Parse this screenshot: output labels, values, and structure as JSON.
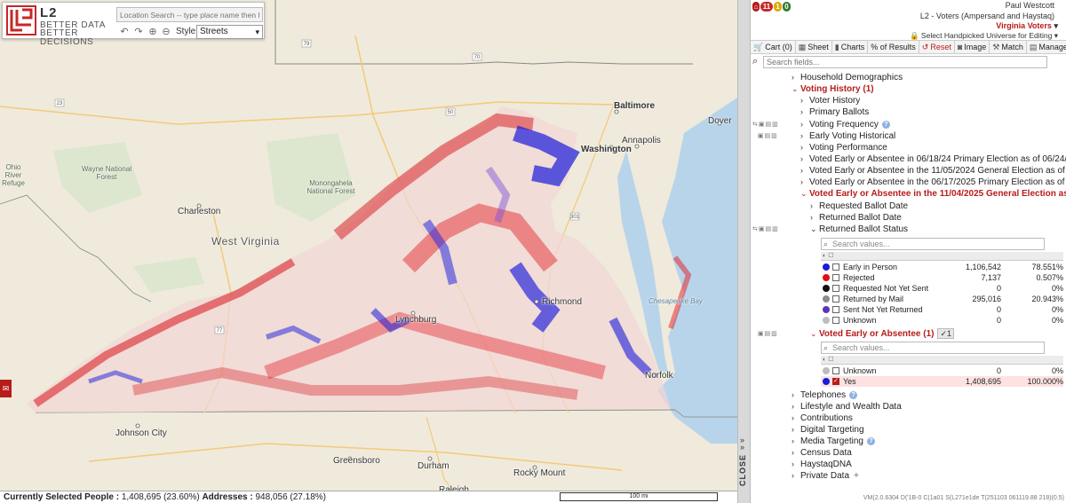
{
  "map": {
    "search_placeholder": "Location Search -- type place name then hit Enter",
    "style_label": "Style",
    "style_value": "Streets",
    "logo": {
      "brand": "L2",
      "tagline_1": "BETTER DATA",
      "tagline_2": "BETTER DECISIONS"
    },
    "places": {
      "baltimore": "Baltimore",
      "washington": "Washington",
      "annapolis": "Annapolis",
      "dover": "Dover",
      "charleston": "Charleston",
      "west_virginia": "West Virginia",
      "richmond": "Richmond",
      "lynchburg": "Lynchburg",
      "norfolk": "Norfolk",
      "johnson_city": "Johnson City",
      "greensboro": "Greensboro",
      "durham": "Durham",
      "raleigh": "Raleigh",
      "rocky_mount": "Rocky Mount",
      "chesapeake_bay": "Chesapeake Bay",
      "wayne_nf": "Wayne National Forest",
      "monongahela_nf": "Monongahela National Forest",
      "ohio_river": "Ohio River Refuge"
    },
    "status": {
      "selected_label": "Currently Selected People :",
      "selected_value": "1,408,695 (23.60%)",
      "addresses_label": "Addresses :",
      "addresses_value": "948,056 (27.18%)"
    },
    "scale": "100 mi",
    "close_label": "CLOSE"
  },
  "panel": {
    "badges": [
      "11",
      "1",
      "0"
    ],
    "user": "Paul Westcott",
    "account": "L2 - Voters (Ampersand and Haystaq)",
    "universe": "Virginia Voters",
    "handpicked": "Select Handpicked Universe for Editing",
    "toolbar": {
      "cart": "Cart (0)",
      "sheet": "Sheet",
      "charts": "Charts",
      "results": "% of Results",
      "reset": "Reset",
      "image": "Image",
      "match": "Match",
      "manage": "Manage",
      "help": "?"
    },
    "search_placeholder": "Search fields...",
    "tree": {
      "household_demographics": "Household Demographics",
      "voting_history": "Voting History (1)",
      "voter_history": "Voter History",
      "primary_ballots": "Primary Ballots",
      "voting_frequency": "Voting Frequency",
      "early_voting_historical": "Early Voting Historical",
      "voting_performance": "Voting Performance",
      "ve_0618": "Voted Early or Absentee in 06/18/24 Primary Election as of 06/24/24",
      "ve_1105": "Voted Early or Absentee in the 11/05/2024 General Election as of 11/11/24",
      "ve_0617": "Voted Early or Absentee in the 06/17/2025 Primary Election as of 06/23/25",
      "ve_1104": "Voted Early or Absentee in the 11/04/2025 General Election as of 11/06/25",
      "requested_ballot_date": "Requested Ballot Date",
      "returned_ballot_date": "Returned Ballot Date",
      "returned_ballot_status": "Returned Ballot Status",
      "voted_early_absentee": "Voted Early or Absentee (1)",
      "telephones": "Telephones",
      "lifestyle_wealth": "Lifestyle and Wealth Data",
      "contributions": "Contributions",
      "digital_targeting": "Digital Targeting",
      "media_targeting": "Media Targeting",
      "census_data": "Census Data",
      "haystaq_dna": "HaystaqDNA",
      "private_data": "Private Data"
    },
    "values_search_placeholder": "Search values...",
    "status_values": [
      {
        "label": "Early in Person",
        "count": "1,106,542",
        "pct": "78.551%",
        "color": "#1a1adb"
      },
      {
        "label": "Rejected",
        "count": "7,137",
        "pct": "0.507%",
        "color": "#e01010"
      },
      {
        "label": "Requested Not Yet Sent",
        "count": "0",
        "pct": "0%",
        "color": "#111111"
      },
      {
        "label": "Returned by Mail",
        "count": "295,016",
        "pct": "20.943%",
        "color": "#8c8c8c"
      },
      {
        "label": "Sent Not Yet Returned",
        "count": "0",
        "pct": "0%",
        "color": "#5e35b1"
      },
      {
        "label": "Unknown",
        "count": "0",
        "pct": "0%",
        "color": "#bdbdbd"
      }
    ],
    "absentee_values": [
      {
        "label": "Unknown",
        "count": "0",
        "pct": "0%",
        "color": "#bdbdbd",
        "checked": false
      },
      {
        "label": "Yes",
        "count": "1,408,695",
        "pct": "100.000%",
        "color": "#1a1adb",
        "checked": true
      }
    ],
    "check_badge": "✓1",
    "version": "VM(2.0.6304 D('1B-0 C(1a01 S(L271e1de T(251103 061119.88 218)(0.5)"
  }
}
